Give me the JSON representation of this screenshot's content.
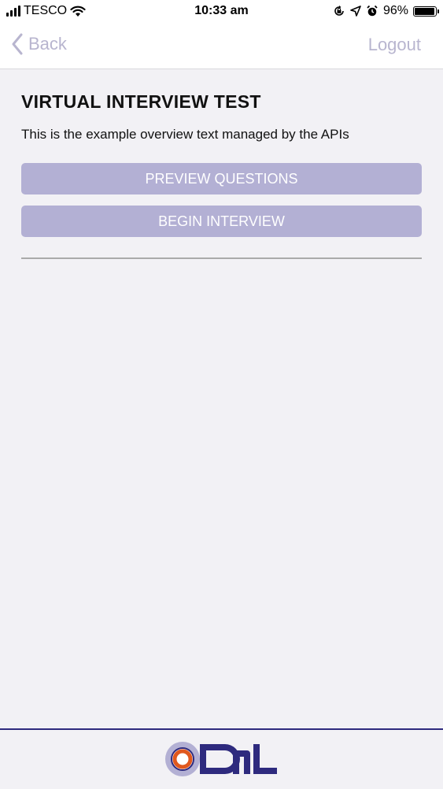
{
  "status_bar": {
    "carrier": "TESCO",
    "time": "10:33 am",
    "battery_percent": "96%",
    "battery_level": 0.96,
    "icons": [
      "signal-icon",
      "wifi-icon",
      "orientation-lock-icon",
      "location-icon",
      "alarm-icon",
      "battery-icon"
    ]
  },
  "nav": {
    "back_label": "Back",
    "logout_label": "Logout",
    "tint_color": "#b8b5cf"
  },
  "main": {
    "title": "VIRTUAL INTERVIEW TEST",
    "overview": "This is the example overview text managed by the APIs",
    "preview_button_label": "PREVIEW QUESTIONS",
    "begin_button_label": "BEGIN INTERVIEW",
    "button_color": "#b3b0d4"
  },
  "footer": {
    "logo_name": "odl-logo",
    "accent_color": "#2e2a7e",
    "logo_ring_color": "#e0581e"
  }
}
